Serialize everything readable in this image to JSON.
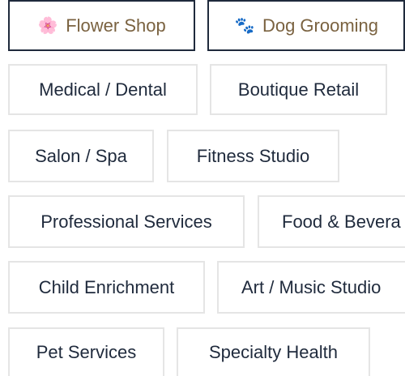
{
  "categories": {
    "selected": [
      {
        "label": "Flower Shop",
        "icon": "🌸",
        "icon_name": "flower-icon"
      },
      {
        "label": "Dog Grooming",
        "icon": "🐾",
        "icon_name": "paw-icon"
      }
    ],
    "options": [
      {
        "label": "Medical / Dental"
      },
      {
        "label": "Boutique Retail"
      },
      {
        "label": "Salon / Spa"
      },
      {
        "label": "Fitness Studio"
      },
      {
        "label": "Professional Services"
      },
      {
        "label": "Food & Bevera"
      },
      {
        "label": "Child Enrichment"
      },
      {
        "label": "Art / Music Studio"
      },
      {
        "label": "Pet Services"
      },
      {
        "label": "Specialty Health"
      }
    ]
  },
  "colors": {
    "text": "#1f2a3c",
    "selected_text": "#7a6240",
    "selected_border": "#1f2a3c",
    "border": "#e5e5e5",
    "flower_icon": "#e8506a",
    "paw_icon": "#1f2a3c"
  }
}
